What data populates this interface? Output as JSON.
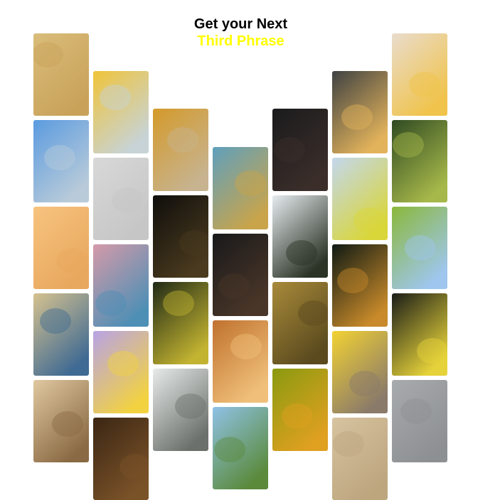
{
  "header": {
    "title": "Get your Next",
    "subtitle": "Third Phrase",
    "subtitle_color": "#ffff00"
  },
  "columns": [
    {
      "tiles": [
        {
          "name": "popcorn-photo",
          "colors": [
            "#d9bd7a",
            "#c9a25a"
          ]
        },
        {
          "name": "building-sky-photo",
          "colors": [
            "#5b9be0",
            "#b9cbd9"
          ]
        },
        {
          "name": "buttons-peach-photo",
          "colors": [
            "#f7c37f",
            "#e8a85e"
          ]
        },
        {
          "name": "wall-shadow-photo",
          "colors": [
            "#d6c28f",
            "#3f6a93"
          ]
        },
        {
          "name": "grains-photo",
          "colors": [
            "#e0c8a0",
            "#8a6a44"
          ]
        }
      ]
    },
    {
      "tiles": [
        {
          "name": "yellow-sweater-globe-photo",
          "colors": [
            "#f0c43a",
            "#c7d3d6"
          ]
        },
        {
          "name": "grey-wall-photo",
          "colors": [
            "#d8d8d8",
            "#c6c6c6"
          ]
        },
        {
          "name": "globe-pink-photo",
          "colors": [
            "#d59aa9",
            "#4d8fb5"
          ]
        },
        {
          "name": "lemon-lavender-photo",
          "colors": [
            "#b8a3e6",
            "#f2d241"
          ]
        },
        {
          "name": "dark-brown-photo",
          "colors": [
            "#3a2614",
            "#7a5228"
          ]
        }
      ]
    },
    {
      "tiles": [
        {
          "name": "globe-amber-photo",
          "colors": [
            "#d49a2a",
            "#c7b38f"
          ]
        },
        {
          "name": "dark-map-photo",
          "colors": [
            "#0f0e0c",
            "#4a3a1e"
          ]
        },
        {
          "name": "dark-meadow-photo",
          "colors": [
            "#202a16",
            "#c2b331"
          ]
        },
        {
          "name": "blurred-rock-photo",
          "colors": [
            "#e6ebea",
            "#6c706c"
          ]
        }
      ]
    },
    {
      "tiles": [
        {
          "name": "leaf-sky-photo",
          "colors": [
            "#5fa0bd",
            "#c9a44a"
          ]
        },
        {
          "name": "dark-leaf-photo",
          "colors": [
            "#18191b",
            "#4a3628"
          ]
        },
        {
          "name": "fur-photo",
          "colors": [
            "#c0722e",
            "#f0c07a"
          ]
        },
        {
          "name": "grass-sky-photo",
          "colors": [
            "#8fc2e6",
            "#5a8a3a"
          ]
        }
      ]
    },
    {
      "tiles": [
        {
          "name": "jeep-wheel-photo",
          "colors": [
            "#1a1b1d",
            "#3b2e2a"
          ]
        },
        {
          "name": "pine-trees-photo",
          "colors": [
            "#e6ecef",
            "#2b3326"
          ]
        },
        {
          "name": "wheat-field-photo",
          "colors": [
            "#a88a3a",
            "#5a4a1e"
          ]
        },
        {
          "name": "butterfly-olive-photo",
          "colors": [
            "#8a9a10",
            "#e0a020"
          ]
        }
      ]
    },
    {
      "tiles": [
        {
          "name": "croissants-photo",
          "colors": [
            "#3f4243",
            "#e3b35b"
          ]
        },
        {
          "name": "sky-flowers-photo",
          "colors": [
            "#c3d7ee",
            "#d9d63a"
          ]
        },
        {
          "name": "dark-green-butterfly-photo",
          "colors": [
            "#0f1a14",
            "#c88a2a"
          ]
        },
        {
          "name": "yellow-ceiling-photo",
          "colors": [
            "#f2d233",
            "#8a7a6a"
          ]
        },
        {
          "name": "sand-photo",
          "colors": [
            "#d6c3a0",
            "#bda57e"
          ]
        }
      ]
    },
    {
      "tiles": [
        {
          "name": "juice-hand-photo",
          "colors": [
            "#e9dccd",
            "#f0c34a"
          ]
        },
        {
          "name": "tropical-leaves-photo",
          "colors": [
            "#2f4a22",
            "#a6b84a"
          ]
        },
        {
          "name": "mirror-meadow-photo",
          "colors": [
            "#8ab83a",
            "#9ec6ee"
          ]
        },
        {
          "name": "dark-bush-flower-photo",
          "colors": [
            "#1a1d18",
            "#e6d23a"
          ]
        },
        {
          "name": "concrete-photo",
          "colors": [
            "#a8abae",
            "#8d9093"
          ]
        }
      ]
    }
  ]
}
